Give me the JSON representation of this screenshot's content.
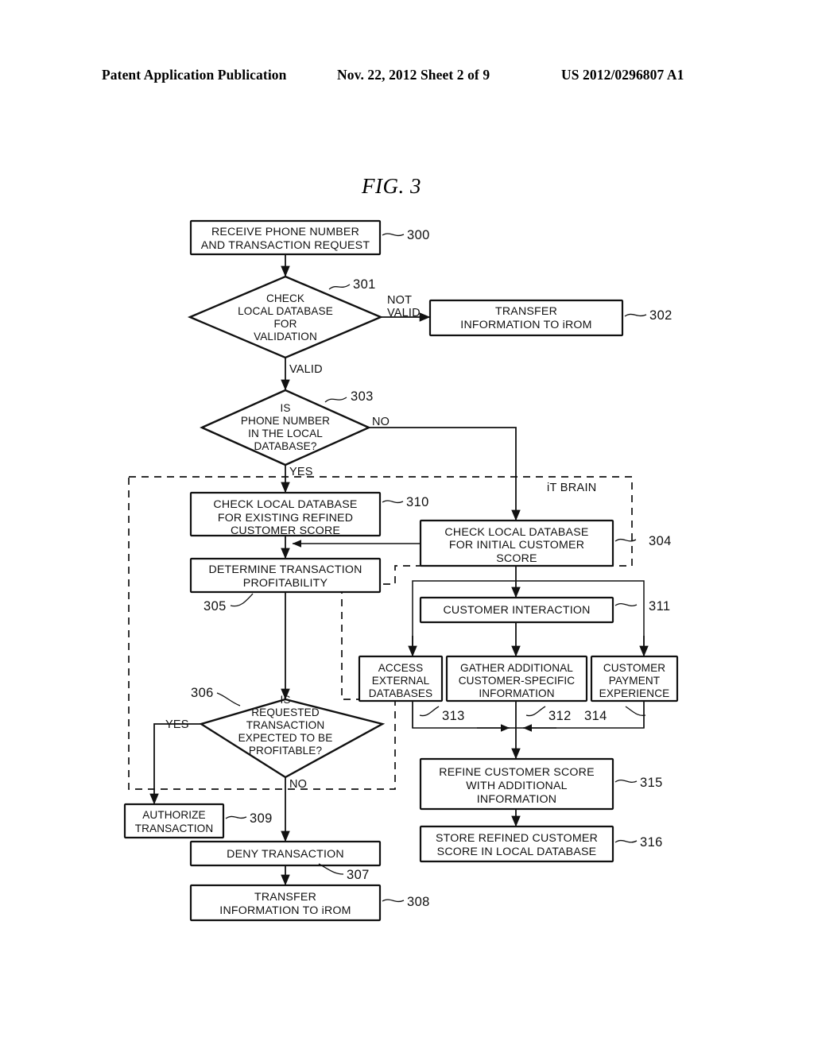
{
  "header": {
    "left": "Patent Application Publication",
    "middle": "Nov. 22, 2012  Sheet 2 of 9",
    "right": "US 2012/0296807 A1"
  },
  "figure": {
    "title": "FIG. 3"
  },
  "groups": {
    "it_brain_label": "iT BRAIN"
  },
  "nodes": {
    "n300": {
      "ref": "300",
      "line1": "RECEIVE PHONE NUMBER",
      "line2": "AND TRANSACTION REQUEST"
    },
    "n301": {
      "ref": "301",
      "line1": "CHECK",
      "line2": "LOCAL DATABASE",
      "line3": "FOR",
      "line4": "VALIDATION"
    },
    "n302": {
      "ref": "302",
      "line1": "TRANSFER",
      "line2": "INFORMATION TO iROM"
    },
    "n303": {
      "ref": "303",
      "line1": "IS",
      "line2": "PHONE NUMBER",
      "line3": "IN THE LOCAL",
      "line4": "DATABASE?"
    },
    "n304": {
      "ref": "304",
      "line1": "CHECK LOCAL DATABASE",
      "line2": "FOR INITIAL CUSTOMER",
      "line3": "SCORE"
    },
    "n305": {
      "ref": "305",
      "line1": "DETERMINE TRANSACTION",
      "line2": "PROFITABILITY"
    },
    "n306": {
      "ref": "306",
      "line1": "IS",
      "line2": "REQUESTED",
      "line3": "TRANSACTION",
      "line4": "EXPECTED TO BE",
      "line5": "PROFITABLE?"
    },
    "n307": {
      "ref": "307",
      "line1": "DENY TRANSACTION"
    },
    "n308": {
      "ref": "308",
      "line1": "TRANSFER",
      "line2": "INFORMATION TO iROM"
    },
    "n309": {
      "ref": "309",
      "line1": "AUTHORIZE",
      "line2": "TRANSACTION"
    },
    "n310": {
      "ref": "310",
      "line1": "CHECK LOCAL DATABASE",
      "line2": "FOR EXISTING REFINED",
      "line3": "CUSTOMER SCORE"
    },
    "n311": {
      "ref": "311",
      "line1": "CUSTOMER INTERACTION"
    },
    "n312": {
      "ref": "312",
      "line1": "GATHER ADDITIONAL",
      "line2": "CUSTOMER-SPECIFIC",
      "line3": "INFORMATION"
    },
    "n313": {
      "ref": "313",
      "line1": "ACCESS",
      "line2": "EXTERNAL",
      "line3": "DATABASES"
    },
    "n314": {
      "ref": "314",
      "line1": "CUSTOMER",
      "line2": "PAYMENT",
      "line3": "EXPERIENCE"
    },
    "n315": {
      "ref": "315",
      "line1": "REFINE CUSTOMER SCORE",
      "line2": "WITH ADDITIONAL",
      "line3": "INFORMATION"
    },
    "n316": {
      "ref": "316",
      "line1": "STORE REFINED CUSTOMER",
      "line2": "SCORE IN LOCAL DATABASE"
    }
  },
  "edge_labels": {
    "not_valid_1": "NOT",
    "not_valid_2": "VALID",
    "valid": "VALID",
    "no_303": "NO",
    "yes_303": "YES",
    "yes_306": "YES",
    "no_306": "NO"
  },
  "colors": {
    "ink": "#111111",
    "paper": "#ffffff"
  }
}
